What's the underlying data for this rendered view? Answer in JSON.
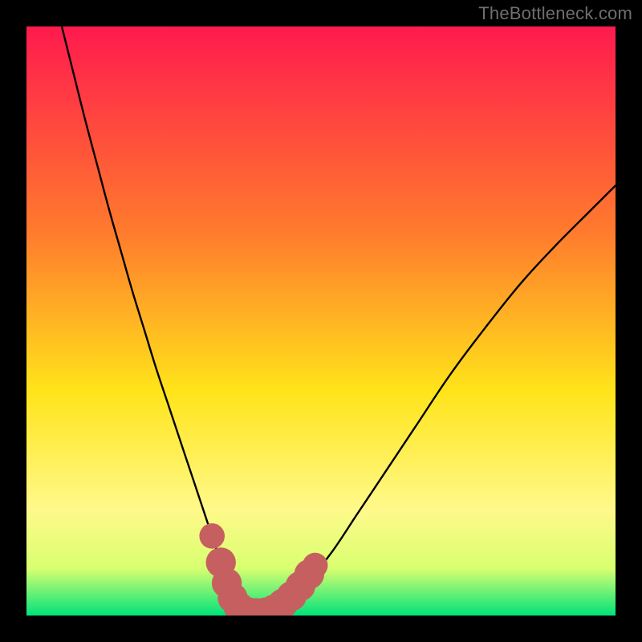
{
  "watermark": "TheBottleneck.com",
  "colors": {
    "frame": "#000000",
    "gradient_top": "#ff1a4e",
    "gradient_mid1": "#ff7b2d",
    "gradient_mid2": "#ffe41a",
    "gradient_low1": "#fff98a",
    "gradient_low2": "#d9ff70",
    "gradient_bottom": "#00e37a",
    "curve": "#000000",
    "marker": "#c66060"
  },
  "chart_data": {
    "type": "line",
    "title": "",
    "xlabel": "",
    "ylabel": "",
    "xlim": [
      0,
      100
    ],
    "ylim": [
      0,
      100
    ],
    "series": [
      {
        "name": "bottleneck-curve",
        "x": [
          6,
          8,
          10,
          12,
          14,
          16,
          18,
          20,
          22,
          24,
          26,
          28,
          30,
          31.5,
          33,
          34.5,
          36,
          38,
          40,
          44,
          48,
          52,
          56,
          60,
          66,
          72,
          78,
          84,
          90,
          96,
          100
        ],
        "values": [
          100,
          92,
          84,
          76.5,
          69,
          62,
          55,
          48.5,
          42,
          36,
          30,
          24,
          18,
          13.5,
          9,
          5,
          2,
          0.5,
          0.5,
          2,
          6,
          11,
          17,
          23,
          32,
          41,
          49,
          56.5,
          63,
          69,
          73
        ]
      }
    ],
    "markers": {
      "name": "highlight-band",
      "points": [
        {
          "x": 31.5,
          "y": 13.5,
          "r": 1.2
        },
        {
          "x": 33.0,
          "y": 9.0,
          "r": 1.6
        },
        {
          "x": 34.0,
          "y": 5.5,
          "r": 1.6
        },
        {
          "x": 35.0,
          "y": 3.0,
          "r": 1.6
        },
        {
          "x": 36.0,
          "y": 1.5,
          "r": 1.6
        },
        {
          "x": 37.5,
          "y": 0.6,
          "r": 1.6
        },
        {
          "x": 39.0,
          "y": 0.4,
          "r": 1.6
        },
        {
          "x": 40.5,
          "y": 0.5,
          "r": 1.6
        },
        {
          "x": 42.0,
          "y": 1.0,
          "r": 1.6
        },
        {
          "x": 43.5,
          "y": 2.0,
          "r": 1.6
        },
        {
          "x": 45.0,
          "y": 3.3,
          "r": 1.6
        },
        {
          "x": 46.5,
          "y": 5.0,
          "r": 1.6
        },
        {
          "x": 48.0,
          "y": 7.0,
          "r": 1.6
        },
        {
          "x": 49.0,
          "y": 8.5,
          "r": 1.2
        }
      ]
    }
  }
}
